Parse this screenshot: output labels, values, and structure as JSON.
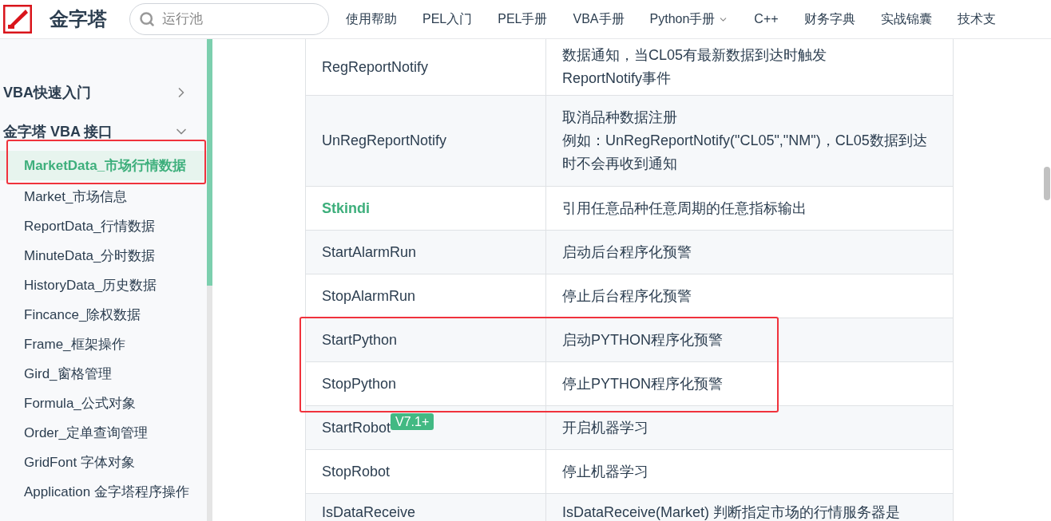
{
  "header": {
    "logo_text": "金字塔",
    "search": {
      "placeholder": "运行池"
    },
    "nav": [
      {
        "label": "使用帮助",
        "has_menu": false
      },
      {
        "label": "PEL入门",
        "has_menu": false
      },
      {
        "label": "PEL手册",
        "has_menu": false
      },
      {
        "label": "VBA手册",
        "has_menu": false
      },
      {
        "label": "Python手册",
        "has_menu": true
      },
      {
        "label": "C++",
        "has_menu": false
      },
      {
        "label": "财务字典",
        "has_menu": false
      },
      {
        "label": "实战锦囊",
        "has_menu": false
      },
      {
        "label": "技术支",
        "has_menu": false
      }
    ]
  },
  "sidebar": {
    "items": [
      {
        "label": "VBA快速入门",
        "expanded": false
      },
      {
        "label": "金字塔 VBA 接口",
        "expanded": true,
        "children": [
          {
            "label": "MarketData_市场行情数据",
            "selected": true,
            "boxed": true
          },
          {
            "label": "Market_市场信息",
            "selected": false,
            "boxed": false
          },
          {
            "label": "ReportData_行情数据",
            "selected": false,
            "boxed": false
          },
          {
            "label": "MinuteData_分时数据",
            "selected": false,
            "boxed": false
          },
          {
            "label": "HistoryData_历史数据",
            "selected": false,
            "boxed": false
          },
          {
            "label": "Fincance_除权数据",
            "selected": false,
            "boxed": false
          },
          {
            "label": "Frame_框架操作",
            "selected": false,
            "boxed": false
          },
          {
            "label": "Gird_窗格管理",
            "selected": false,
            "boxed": false
          },
          {
            "label": "Formula_公式对象",
            "selected": false,
            "boxed": false
          },
          {
            "label": "Order_定单查询管理",
            "selected": false,
            "boxed": false
          },
          {
            "label": "GridFont 字体对象",
            "selected": false,
            "boxed": false
          },
          {
            "label": "Application 金字塔程序操作",
            "selected": false,
            "boxed": false
          }
        ]
      }
    ]
  },
  "table": {
    "rows": [
      {
        "name": "RegReportNotify",
        "kind": "text",
        "description": [
          "数据通知，当CL05有最新数据到达时触发",
          "ReportNotify事件"
        ],
        "boxed": false
      },
      {
        "name": "UnRegReportNotify",
        "kind": "text",
        "description": [
          "取消品种数据注册",
          "例如：UnRegReportNotify(\"CL05\",\"NM\")，CL05数据到达时不会再收到通知"
        ],
        "boxed": false
      },
      {
        "name": "Stkindi",
        "kind": "link",
        "description": [
          "引用任意品种任意周期的任意指标输出"
        ],
        "boxed": false
      },
      {
        "name": "StartAlarmRun",
        "kind": "text",
        "description": [
          "启动后台程序化预警"
        ],
        "boxed": false
      },
      {
        "name": "StopAlarmRun",
        "kind": "text",
        "description": [
          "停止后台程序化预警"
        ],
        "boxed": false
      },
      {
        "name": "StartPython",
        "kind": "text",
        "description": [
          "启动PYTHON程序化预警"
        ],
        "boxed": true
      },
      {
        "name": "StopPython",
        "kind": "text",
        "description": [
          "停止PYTHON程序化预警"
        ],
        "boxed": true
      },
      {
        "name": "StartRobot",
        "kind": "text",
        "badge": "V7.1+",
        "description": [
          "开启机器学习"
        ],
        "boxed": false
      },
      {
        "name": "StopRobot",
        "kind": "text",
        "description": [
          "停止机器学习"
        ],
        "boxed": false
      },
      {
        "name": "IsDataReceive",
        "kind": "text",
        "description": [
          "IsDataReceive(Market) 判断指定市场的行情服务器是"
        ],
        "boxed": false
      }
    ]
  }
}
